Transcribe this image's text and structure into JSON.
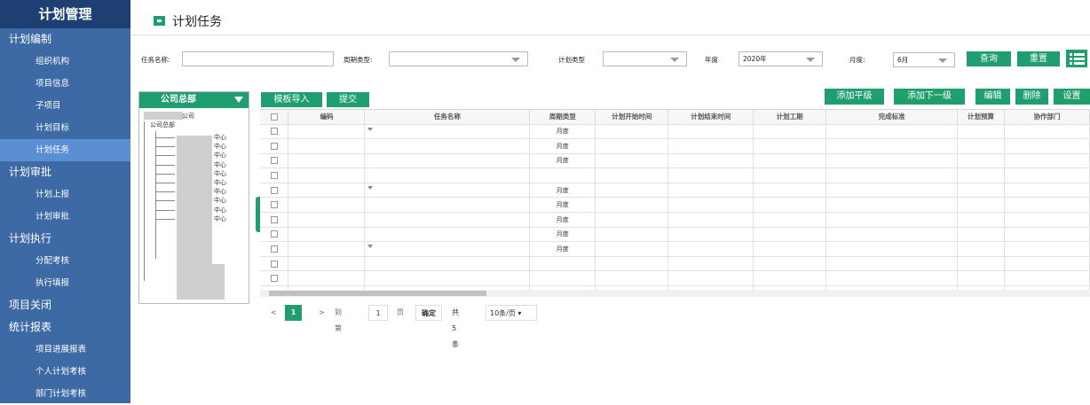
{
  "sidebar": {
    "title": "计划管理",
    "items": [
      {
        "label": "计划编制",
        "level": "group"
      },
      {
        "label": "组织机构",
        "level": "sub"
      },
      {
        "label": "项目信息",
        "level": "sub"
      },
      {
        "label": "子项目",
        "level": "sub"
      },
      {
        "label": "计划目标",
        "level": "sub"
      },
      {
        "label": "计划任务",
        "level": "sub",
        "active": true
      },
      {
        "label": "计划审批",
        "level": "group"
      },
      {
        "label": "计划上报",
        "level": "sub"
      },
      {
        "label": "计划审批",
        "level": "sub"
      },
      {
        "label": "计划执行",
        "level": "group"
      },
      {
        "label": "分配考核",
        "level": "sub"
      },
      {
        "label": "执行填报",
        "level": "sub"
      },
      {
        "label": "项目关闭",
        "level": "group"
      },
      {
        "label": "统计报表",
        "level": "group"
      },
      {
        "label": "项目进展报表",
        "level": "sub"
      },
      {
        "label": "个人计划考核",
        "level": "sub"
      },
      {
        "label": "部门计划考核",
        "level": "sub"
      }
    ]
  },
  "page": {
    "title": "计划任务"
  },
  "filters": {
    "task_name_label": "任务名称:",
    "task_name_value": "",
    "period_type_label": "周期类型:",
    "period_type_value": "",
    "plan_type_label": "计划类型",
    "plan_type_value": "",
    "year_label": "年度",
    "year_value": "2020年",
    "month_label": "月度:",
    "month_value": "6月",
    "query_label": "查询",
    "reset_label": "重置"
  },
  "toolbar": {
    "template_import": "模板导入",
    "submit": "提交",
    "add_sibling": "添加平级",
    "add_child": "添加下一级",
    "edit": "编辑",
    "delete": "删除",
    "settings": "设置"
  },
  "tree": {
    "header": "公司总部",
    "nodes": [
      "公司",
      "公司总部",
      "中心",
      "中心",
      "中心",
      "中心",
      "中心",
      "中心",
      "中心",
      "中心",
      "中心",
      "中心"
    ]
  },
  "table": {
    "columns": [
      "编码",
      "任务名称",
      "周期类型",
      "计划开始时间",
      "计划结束时间",
      "计划工期",
      "完成标准",
      "计划预算",
      "协作部门"
    ],
    "rows": [
      {
        "period": "月度",
        "dropdown": true
      },
      {
        "period": "月度",
        "dropdown": false
      },
      {
        "period": "月度",
        "dropdown": false
      },
      {
        "period": "",
        "dropdown": false
      },
      {
        "period": "月度",
        "dropdown": true
      },
      {
        "period": "月度",
        "dropdown": false
      },
      {
        "period": "月度",
        "dropdown": false
      },
      {
        "period": "月度",
        "dropdown": false
      },
      {
        "period": "月度",
        "dropdown": true
      },
      {
        "period": "",
        "dropdown": false
      },
      {
        "period": "",
        "dropdown": false
      },
      {
        "period": "",
        "dropdown": false
      }
    ]
  },
  "pager": {
    "current_page": "1",
    "goto_label": "到第",
    "goto_value": "1",
    "page_unit": "页",
    "confirm": "确定",
    "total": "共5条",
    "per_page": "10条/页"
  },
  "colors": {
    "sidebar_bg": "#3d6aa5",
    "sidebar_title_bg": "#1e3f72",
    "active_item": "#5b8fd4",
    "accent_green": "#1f9e6e"
  }
}
